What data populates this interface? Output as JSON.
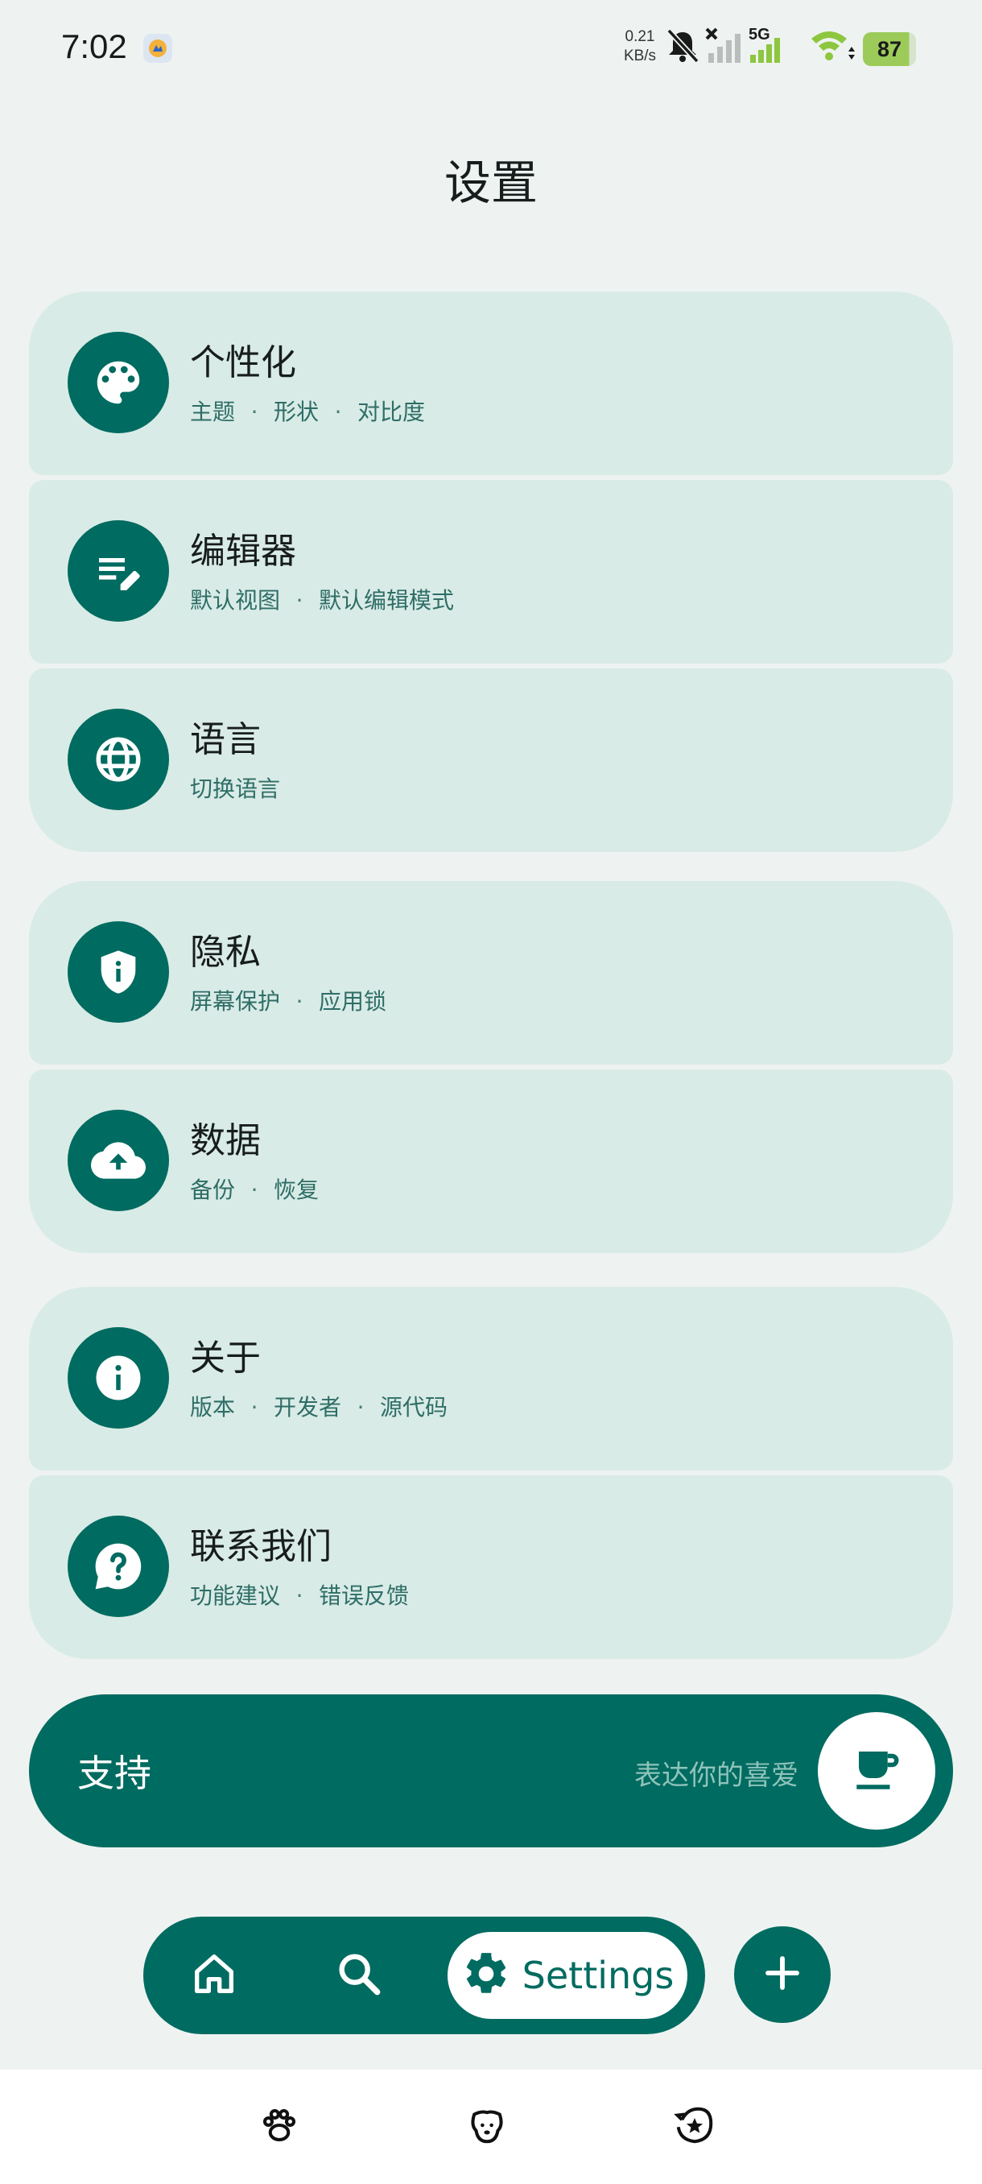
{
  "status_bar": {
    "time": "7:02",
    "net_speed_value": "0.21",
    "net_speed_unit": "KB/s",
    "network_label": "5G",
    "battery": "87",
    "icons": [
      "app-notification-icon",
      "bell-off-icon",
      "no-signal-icon",
      "5g-signal-icon",
      "wifi-icon",
      "battery-icon"
    ]
  },
  "header": {
    "title": "设置"
  },
  "groups": [
    {
      "items": [
        {
          "icon": "palette-icon",
          "title": "个性化",
          "subtitle": [
            "主题",
            "形状",
            "对比度"
          ]
        },
        {
          "icon": "edit-note-icon",
          "title": "编辑器",
          "subtitle": [
            "默认视图",
            "默认编辑模式"
          ]
        },
        {
          "icon": "globe-icon",
          "title": "语言",
          "subtitle": [
            "切换语言"
          ]
        }
      ]
    },
    {
      "items": [
        {
          "icon": "shield-info-icon",
          "title": "隐私",
          "subtitle": [
            "屏幕保护",
            "应用锁"
          ]
        },
        {
          "icon": "cloud-upload-icon",
          "title": "数据",
          "subtitle": [
            "备份",
            "恢复"
          ]
        }
      ]
    },
    {
      "items": [
        {
          "icon": "info-icon",
          "title": "关于",
          "subtitle": [
            "版本",
            "开发者",
            "源代码"
          ]
        },
        {
          "icon": "help-bubble-icon",
          "title": "联系我们",
          "subtitle": [
            "功能建议",
            "错误反馈"
          ]
        }
      ]
    }
  ],
  "support": {
    "label": "支持",
    "hint": "表达你的喜爱",
    "icon": "coffee-cup-icon"
  },
  "bottom_nav": {
    "items": [
      {
        "icon": "home-icon",
        "label": ""
      },
      {
        "icon": "search-icon",
        "label": ""
      },
      {
        "icon": "gear-icon",
        "label": "Settings",
        "active": true
      }
    ],
    "fab_icon": "plus-icon"
  },
  "system_nav": {
    "icons": [
      "paw-icon",
      "dog-face-icon",
      "star-back-icon"
    ]
  },
  "colors": {
    "background": "#EEF3F1",
    "card": "#D9EBE7",
    "accent": "#006B60",
    "subtitle": "#2E6E66"
  }
}
